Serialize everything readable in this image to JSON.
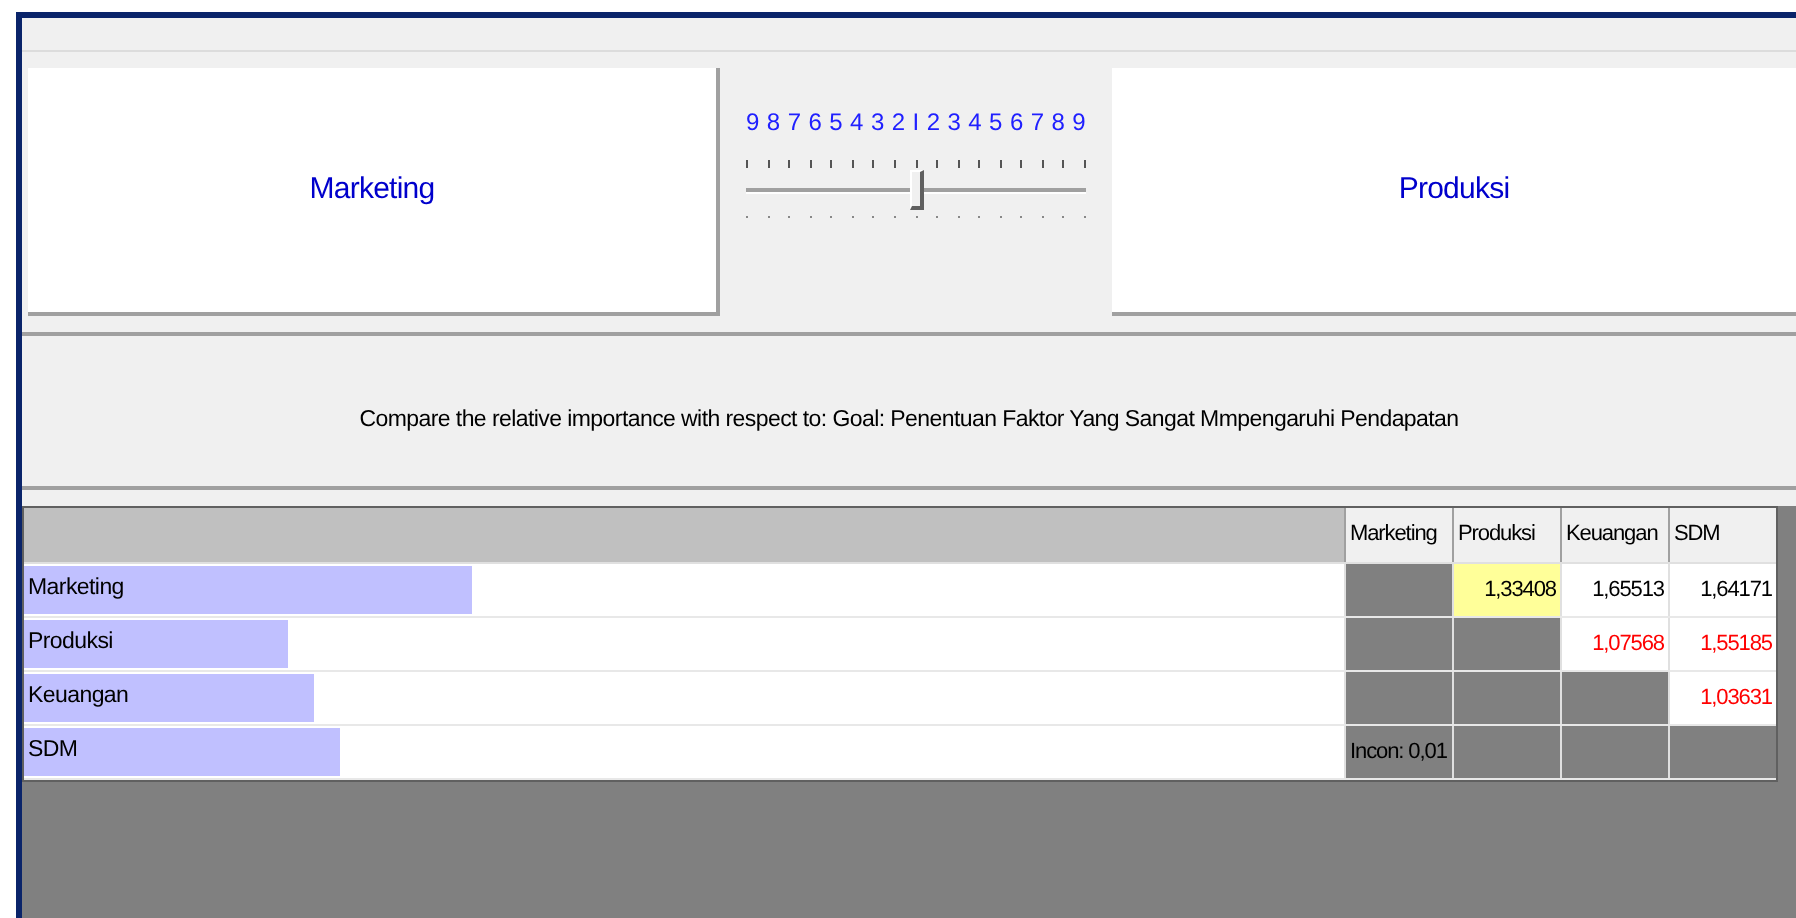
{
  "left_box": {
    "label": "Marketing"
  },
  "right_box": {
    "label": "Produksi"
  },
  "scale": {
    "labels": [
      "9",
      "8",
      "7",
      "6",
      "5",
      "4",
      "3",
      "2",
      "I",
      "2",
      "3",
      "4",
      "5",
      "6",
      "7",
      "8",
      "9"
    ],
    "level": 0.5
  },
  "prompt": "Compare the relative importance with respect to: Goal: Penentuan Faktor Yang Sangat Mmpengaruhi Pendapatan",
  "matrix": {
    "columns": [
      "Marketing",
      "Produksi",
      "Keuangan",
      "SDM"
    ],
    "rows": [
      {
        "label": "Marketing",
        "cells": [
          {
            "kind": "blank"
          },
          {
            "kind": "value",
            "text": "1,33408",
            "color": "#000000",
            "selected": true
          },
          {
            "kind": "value",
            "text": "1,65513",
            "color": "#000000",
            "selected": false
          },
          {
            "kind": "value",
            "text": "1,64171",
            "color": "#000000",
            "selected": false
          }
        ]
      },
      {
        "label": "Produksi",
        "cells": [
          {
            "kind": "blank"
          },
          {
            "kind": "blank"
          },
          {
            "kind": "value",
            "text": "1,07568",
            "color": "#ff0000",
            "selected": false
          },
          {
            "kind": "value",
            "text": "1,55185",
            "color": "#ff0000",
            "selected": false
          }
        ]
      },
      {
        "label": "Keuangan",
        "cells": [
          {
            "kind": "blank"
          },
          {
            "kind": "blank"
          },
          {
            "kind": "blank"
          },
          {
            "kind": "value",
            "text": "1,03631",
            "color": "#ff0000",
            "selected": false
          }
        ]
      },
      {
        "label": "SDM",
        "cells": [
          {
            "kind": "note",
            "text": "Incon: 0,01"
          },
          {
            "kind": "blank"
          },
          {
            "kind": "blank"
          },
          {
            "kind": "blank"
          }
        ]
      }
    ]
  }
}
